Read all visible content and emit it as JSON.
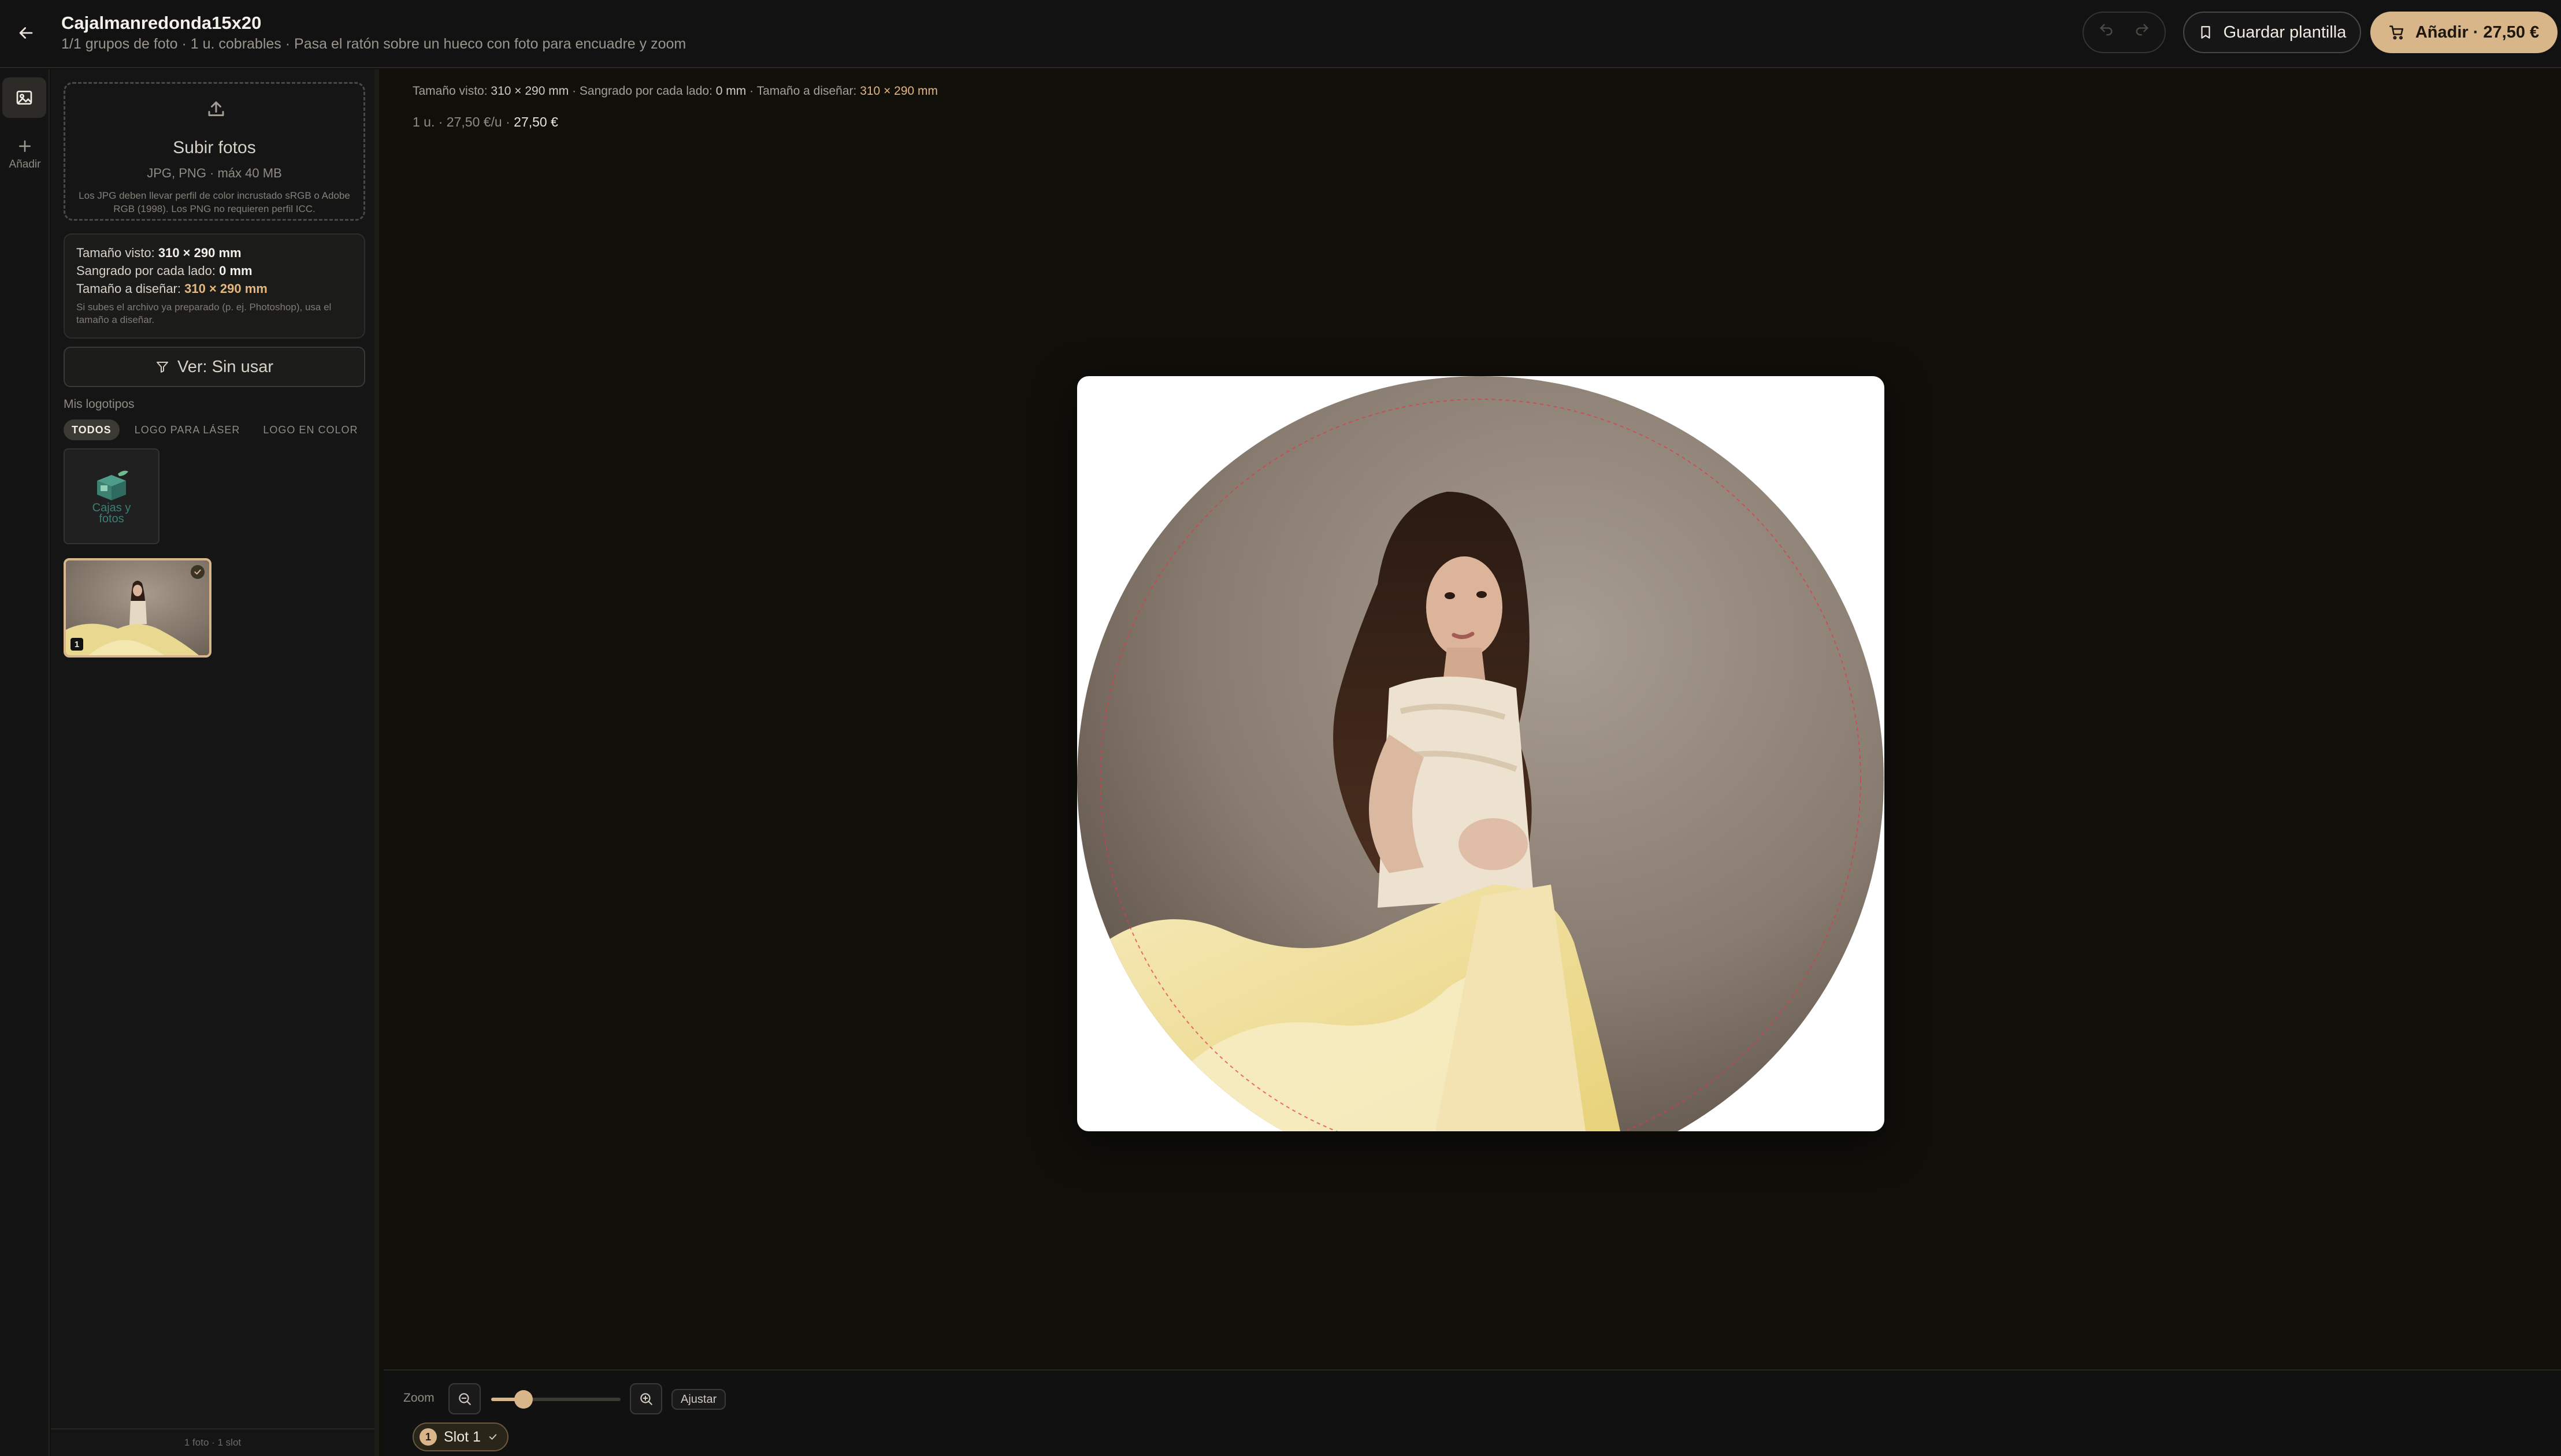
{
  "header": {
    "title": "Cajalmanredonda15x20",
    "subtitle": "1/1 grupos de foto · 1 u. cobrables · Pasa el ratón sobre un hueco con foto para encuadre y zoom",
    "save_template_label": "Guardar plantilla",
    "add_cart_label": "Añadir · 27,50 €"
  },
  "rail": {
    "add_label": "Añadir"
  },
  "sidebar": {
    "upload": {
      "title": "Subir fotos",
      "formats": "JPG, PNG · máx 40 MB",
      "note": "Los JPG deben llevar perfil de color incrustado sRGB o Adobe RGB (1998). Los PNG no requieren perfil ICC."
    },
    "info": {
      "seen_label": "Tamaño visto:",
      "seen_value": "310 × 290 mm",
      "bleed_label": "Sangrado por cada lado:",
      "bleed_value": "0 mm",
      "design_label": "Tamaño a diseñar:",
      "design_value": "310 × 290 mm",
      "hint": "Si subes el archivo ya preparado (p. ej. Photoshop), usa el tamaño a diseñar."
    },
    "filter_label": "Ver: Sin usar",
    "logos_label": "Mis logotipos",
    "logo_tabs": [
      "TODOS",
      "LOGO PARA LÁSER",
      "LOGO EN COLOR"
    ],
    "logo_thumb_text_1": "Cajas y",
    "logo_thumb_text_2": "fotos",
    "photo_badge": "1",
    "footer": "1 foto · 1 slot"
  },
  "main": {
    "info_seen_label": "Tamaño visto:",
    "info_seen_value": "310 × 290 mm",
    "info_bleed_label": "Sangrado por cada lado:",
    "info_bleed_value": "0 mm",
    "info_design_label": "Tamaño a diseñar:",
    "info_design_value": "310 × 290 mm",
    "price_prefix": "1 u. · 27,50 €/u ·",
    "price_total": "27,50 €"
  },
  "bottom": {
    "zoom_label": "Zoom",
    "zoom_level": 0.25,
    "fit_label": "Ajustar",
    "slot_number": "1",
    "slot_label": "Slot 1"
  },
  "colors": {
    "accent": "#d9b68a",
    "accent_text": "#e3b77f",
    "background": "#100f0a",
    "panel": "#151515",
    "bleed_guide": "#e0384a"
  },
  "icons": {
    "back": "arrow-left-icon",
    "undo": "undo-icon",
    "redo": "redo-icon",
    "bookmark": "bookmark-icon",
    "cart": "cart-icon",
    "photos": "image-icon",
    "add": "plus-icon",
    "upload": "upload-icon",
    "filter": "filter-icon",
    "zoom_out": "zoom-out-icon",
    "zoom_in": "zoom-in-icon",
    "check": "check-icon"
  }
}
